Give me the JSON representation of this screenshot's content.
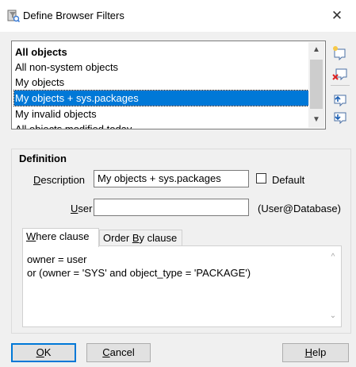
{
  "window": {
    "title": "Define Browser Filters",
    "close_glyph": "✕",
    "icon": "filter-funnel-icon"
  },
  "filters": {
    "items": [
      {
        "label": "All objects",
        "bold": true,
        "selected": false
      },
      {
        "label": "All non-system objects",
        "bold": false,
        "selected": false
      },
      {
        "label": "My objects",
        "bold": false,
        "selected": false
      },
      {
        "label": "My objects + sys.packages",
        "bold": false,
        "selected": true
      },
      {
        "label": "My invalid objects",
        "bold": false,
        "selected": false
      },
      {
        "label": "All objects modified today",
        "bold": false,
        "selected": false
      }
    ],
    "tools": [
      "new-filter-icon",
      "delete-filter-icon",
      "move-up-icon",
      "move-down-icon"
    ]
  },
  "definition": {
    "group_label": "Definition",
    "description_label_u": "D",
    "description_label_rest": "escription",
    "description_value": "My objects + sys.packages",
    "default_label": "Default",
    "default_checked": false,
    "user_label_u": "U",
    "user_label_rest": "ser",
    "user_value": "",
    "user_hint": "(User@Database)",
    "tabs": [
      {
        "u": "W",
        "rest": "here clause",
        "pre": "",
        "active": true
      },
      {
        "u": "B",
        "rest": "y clause",
        "pre": "Order ",
        "active": false
      }
    ],
    "clause_text": "owner = user\nor (owner = 'SYS' and object_type = 'PACKAGE')"
  },
  "buttons": {
    "ok_u": "O",
    "ok_rest": "K",
    "cancel_u": "C",
    "cancel_rest": "ancel",
    "help_u": "H",
    "help_rest": "elp"
  },
  "colors": {
    "selection": "#0078d7",
    "dialog_bg": "#f0f0f0"
  }
}
